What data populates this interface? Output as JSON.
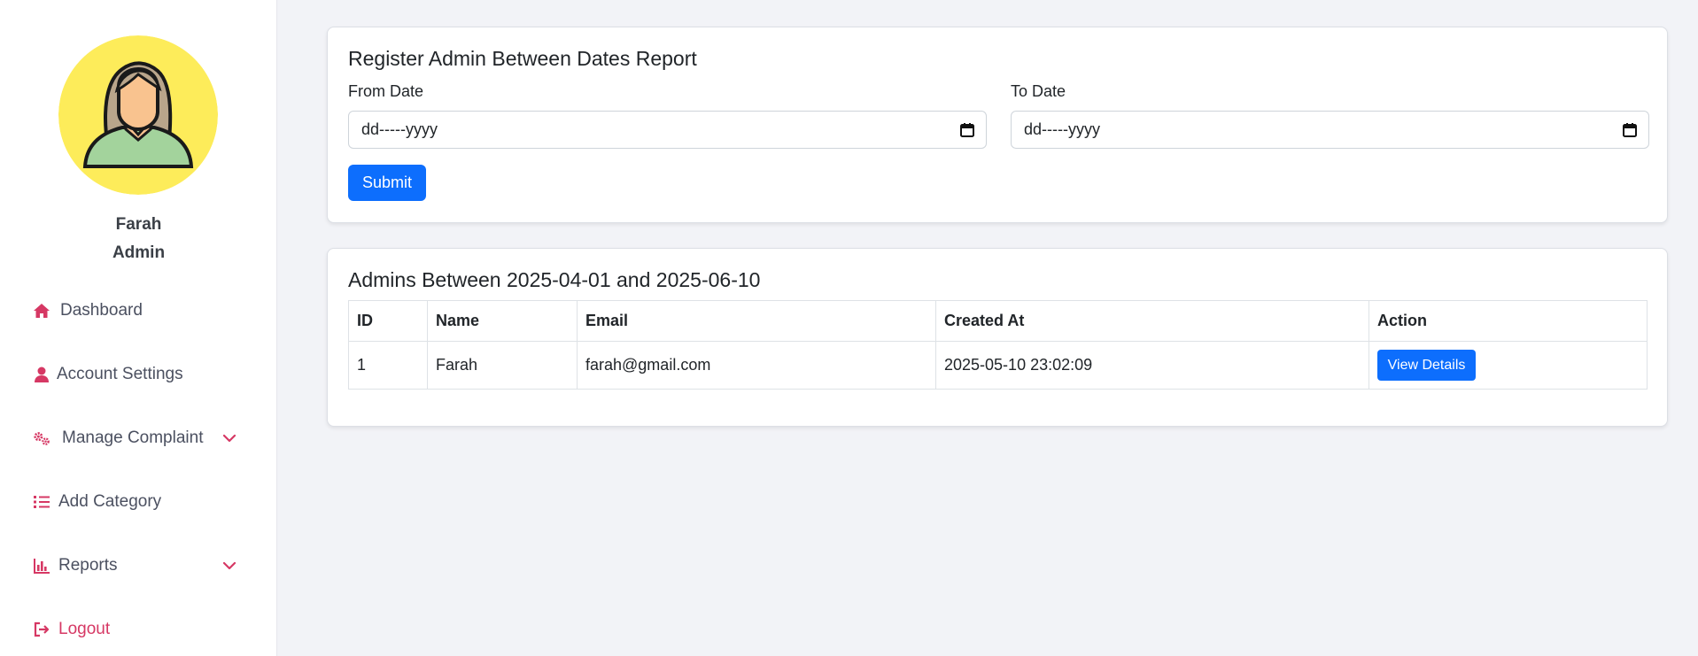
{
  "user": {
    "name": "Farah",
    "role": "Admin"
  },
  "nav": {
    "dashboard": "Dashboard",
    "account_settings": "Account Settings",
    "manage_complaint": "Manage Complaint",
    "add_category": "Add Category",
    "reports": "Reports",
    "logout": "Logout"
  },
  "form": {
    "title": "Register Admin Between Dates Report",
    "from_label": "From Date",
    "to_label": "To Date",
    "from_value": "dd-----yyyy",
    "to_value": "dd-----yyyy",
    "submit_label": "Submit"
  },
  "results": {
    "title": "Admins Between 2025-04-01 and 2025-06-10",
    "headers": [
      "ID",
      "Name",
      "Email",
      "Created At",
      "Action"
    ],
    "rows": [
      {
        "id": "1",
        "name": "Farah",
        "email": "farah@gmail.com",
        "created_at": "2025-05-10 23:02:09",
        "action": "View Details"
      }
    ]
  },
  "colors": {
    "accent": "#d63864",
    "primary": "#0d6efd",
    "avatar_bg": "#fdec5a"
  },
  "icons": {
    "dashboard": "house-icon",
    "account_settings": "user-icon",
    "manage_complaint": "gears-icon",
    "add_category": "list-icon",
    "reports": "chart-bar-icon",
    "logout": "sign-out-icon"
  }
}
